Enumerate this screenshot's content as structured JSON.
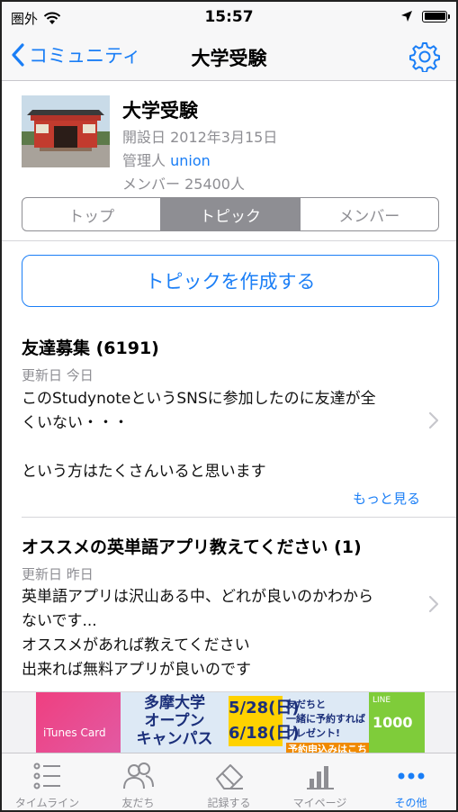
{
  "status_bar": {
    "carrier": "圏外",
    "time": "15:57"
  },
  "nav": {
    "back_label": "コミュニティ",
    "title": "大学受験"
  },
  "community": {
    "name": "大学受験",
    "opened": "開設日 2012年3月15日",
    "admin_prefix": "管理人 ",
    "admin_name": "union",
    "members": "メンバー 25400人"
  },
  "segments": [
    {
      "label": "トップ",
      "active": false
    },
    {
      "label": "トピック",
      "active": true
    },
    {
      "label": "メンバー",
      "active": false
    }
  ],
  "create_topic_label": "トピックを作成する",
  "topics": [
    {
      "title": "友達募集 (6191)",
      "updated": "更新日 今日",
      "body_lines": [
        "このStudynoteというSNSに参加したのに友達が全",
        "くいない・・・",
        "",
        "という方はたくさんいると思います"
      ],
      "more": "もっと見る"
    },
    {
      "title": "オススメの英単語アプリ教えてください (1)",
      "updated": "更新日 昨日",
      "body_lines": [
        "英単語アプリは沢山ある中、どれが良いのかわから",
        "ないです...",
        "オススメがあれば教えてください",
        "出来れば無料アプリが良いのです"
      ]
    }
  ],
  "ad": {
    "card_text": "iTunes Card",
    "main_lines": [
      "多摩大学",
      "オープン",
      "キャンパス"
    ],
    "dates": [
      "5/28(日)",
      "6/18(日)"
    ],
    "side_lines": [
      "友だちと",
      "一緒に予約すれば",
      "プレゼント!"
    ],
    "cta": "予約申込みはこちら",
    "line_label": "LINE",
    "line_amount": "1000"
  },
  "tabs": [
    {
      "label": "タイムライン",
      "icon": "list-icon",
      "active": false
    },
    {
      "label": "友だち",
      "icon": "friends-icon",
      "active": false
    },
    {
      "label": "記録する",
      "icon": "eraser-icon",
      "active": false
    },
    {
      "label": "マイページ",
      "icon": "bar-chart-icon",
      "active": false
    },
    {
      "label": "その他",
      "icon": "more-icon",
      "active": true
    }
  ],
  "colors": {
    "accent": "#1a7ef6",
    "muted": "#8e8e93"
  }
}
